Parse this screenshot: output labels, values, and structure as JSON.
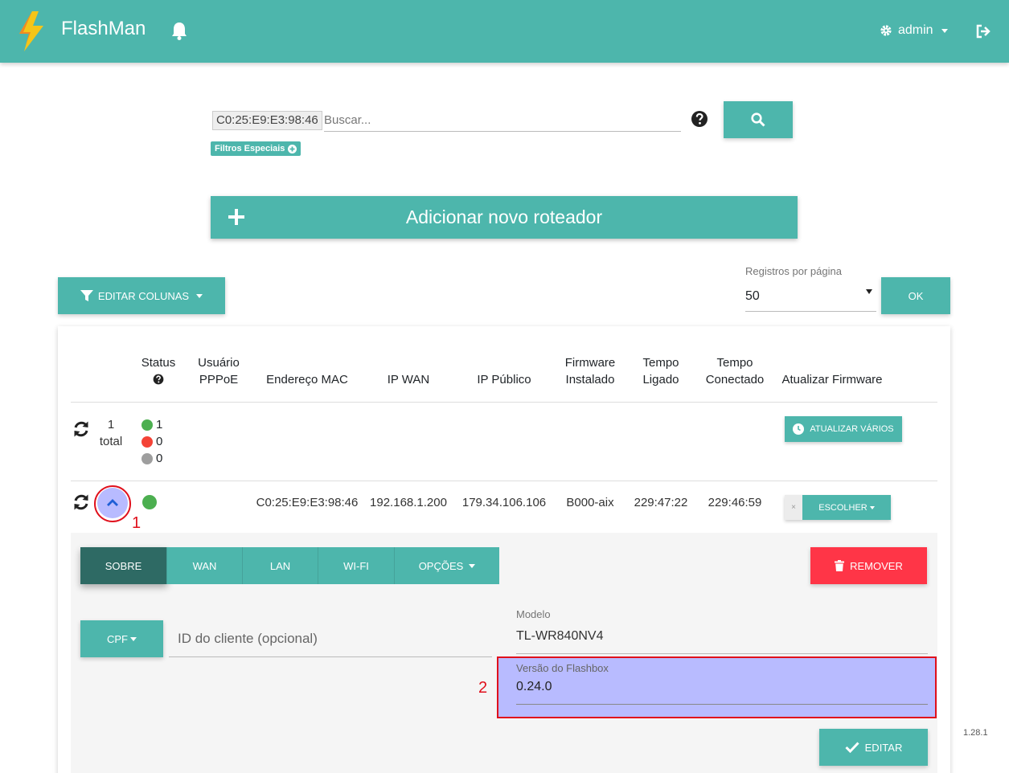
{
  "navbar": {
    "brand": "FlashMan",
    "user": "admin"
  },
  "search": {
    "mac_chip": "C0:25:E9:E3:98:46",
    "placeholder": "Buscar...",
    "filters_label": "Filtros Especiais"
  },
  "add_router": {
    "label": "Adicionar novo roteador"
  },
  "toolbar": {
    "edit_columns": "EDITAR COLUNAS",
    "per_page_label": "Registros por página",
    "per_page_value": "50",
    "ok": "OK"
  },
  "table": {
    "headers": {
      "status": "Status",
      "pppoe_1": "Usuário",
      "pppoe_2": "PPPoE",
      "mac": "Endereço MAC",
      "ip_wan": "IP WAN",
      "ip_public": "IP Público",
      "firmware_1": "Firmware",
      "firmware_2": "Instalado",
      "uptime_1": "Tempo",
      "uptime_2": "Ligado",
      "connected_1": "Tempo",
      "connected_2": "Conectado",
      "update_fw": "Atualizar Firmware"
    },
    "summary": {
      "count": "1",
      "total_label": "total",
      "online": "1",
      "offline": "0",
      "unknown": "0",
      "update_many": "ATUALIZAR VÁRIOS"
    },
    "row": {
      "mac": "C0:25:E9:E3:98:46",
      "ip_wan": "192.168.1.200",
      "ip_public": "179.34.106.106",
      "firmware": "B000-aix",
      "uptime": "229:47:22",
      "connected": "229:46:59",
      "choose": "ESCOLHER",
      "choose_x": "×"
    }
  },
  "details": {
    "tabs": [
      "SOBRE",
      "WAN",
      "LAN",
      "WI-FI",
      "OPÇÕES"
    ],
    "remove": "REMOVER",
    "cpf": "CPF",
    "client_id_placeholder": "ID do cliente (opcional)",
    "model_label": "Modelo",
    "model_value": "TL-WR840NV4",
    "flashbox_label": "Versão do Flashbox",
    "flashbox_value": "0.24.0",
    "edit": "EDITAR"
  },
  "annotations": {
    "marker_1": "1",
    "marker_2": "2"
  },
  "app_version": "1.28.1",
  "colors": {
    "primary": "#4db6ac",
    "danger": "#ff3547",
    "online": "#4caf50",
    "offline": "#f44336",
    "unknown": "#9e9e9e",
    "highlight": "#b8bbff",
    "annotation": "#e0101c"
  }
}
